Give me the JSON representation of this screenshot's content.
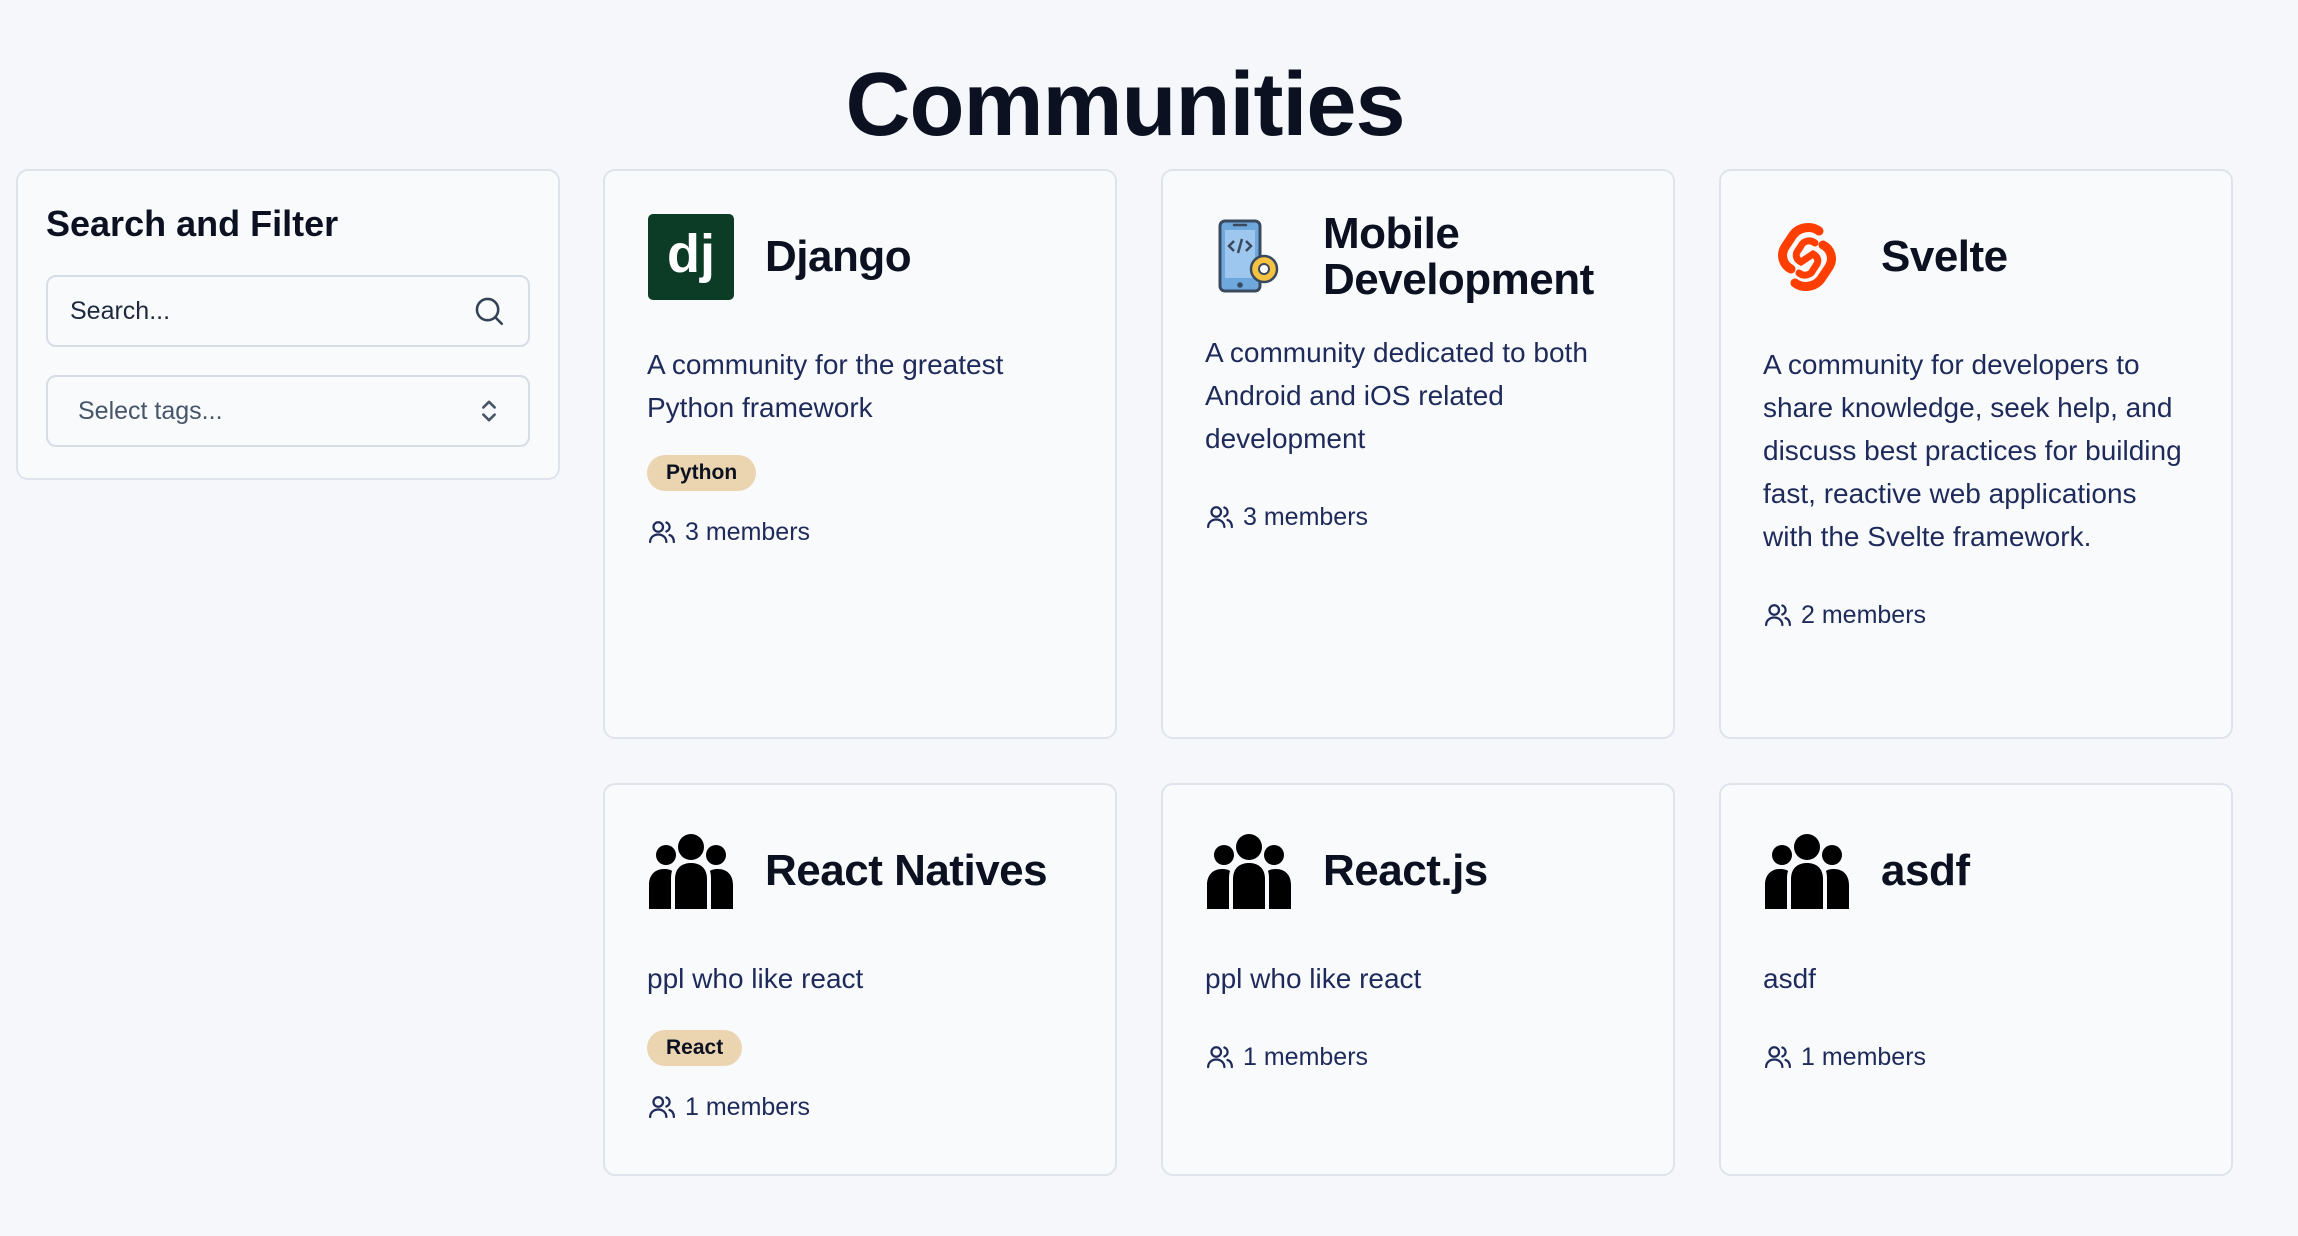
{
  "page": {
    "title": "Communities"
  },
  "sidebar": {
    "title": "Search and Filter",
    "search": {
      "placeholder": "Search...",
      "icon": "search-icon"
    },
    "tags": {
      "placeholder": "Select tags...",
      "icon": "chevron-up-down-icon"
    }
  },
  "colors": {
    "background": "#f5f7fa",
    "tag": "#ead5b0",
    "django_logo": "#0c3c26",
    "svelte_logo": "#ff3e00"
  },
  "communities": [
    {
      "name": "Django",
      "description": "A community for the greatest Python framework",
      "tag": "Python",
      "members": "3 members",
      "icon": "django-logo"
    },
    {
      "name": "Mobile Development",
      "description": "A community dedicated to both Android and iOS related development",
      "tag": "",
      "members": "3 members",
      "icon": "mobile-development-icon"
    },
    {
      "name": "Svelte",
      "description": "A community for developers to share knowledge, seek help, and discuss best practices for building fast, reactive web applications with the Svelte framework.",
      "tag": "",
      "members": "2 members",
      "icon": "svelte-logo"
    },
    {
      "name": "React Natives",
      "description": "ppl who like react",
      "tag": "React",
      "members": "1 members",
      "icon": "people-group-icon"
    },
    {
      "name": "React.js",
      "description": "ppl who like react",
      "tag": "",
      "members": "1 members",
      "icon": "people-group-icon"
    },
    {
      "name": "asdf",
      "description": "asdf",
      "tag": "",
      "members": "1 members",
      "icon": "people-group-icon"
    }
  ]
}
